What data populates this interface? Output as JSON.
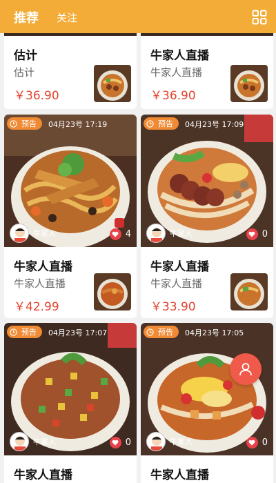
{
  "header": {
    "tab_active": "推荐",
    "tab_follow": "关注",
    "menu_icon": "grid-icon"
  },
  "cards": [
    {
      "title": "估计",
      "subtitle": "估计",
      "price": "￥36.90"
    },
    {
      "title": "牛家人直播",
      "subtitle": "牛家人直播",
      "price": "￥36.90"
    },
    {
      "badge": "预告",
      "datetime": "04月23号 17:19",
      "owner": "牛家人",
      "likes": "4",
      "title": "牛家人直播",
      "subtitle": "牛家人直播",
      "price": "￥42.99"
    },
    {
      "badge": "预告",
      "datetime": "04月23号 17:09",
      "owner": "牛家人",
      "likes": "0",
      "title": "牛家人直播",
      "subtitle": "牛家人直播",
      "price": "￥33.90"
    },
    {
      "badge": "预告",
      "datetime": "04月23号 17:07",
      "owner": "牛家人",
      "likes": "0",
      "title": "牛家人直播"
    },
    {
      "badge": "预告",
      "datetime": "04月23号 17:05",
      "owner": "牛家人",
      "likes": "0",
      "title": "牛家人直播"
    }
  ],
  "colors": {
    "header": "#f2ac37",
    "badge": "#f08a34",
    "price": "#e2432f",
    "heart": "#e8424a",
    "fab": "#ef5a4a"
  },
  "fab": {
    "icon": "user-icon"
  }
}
